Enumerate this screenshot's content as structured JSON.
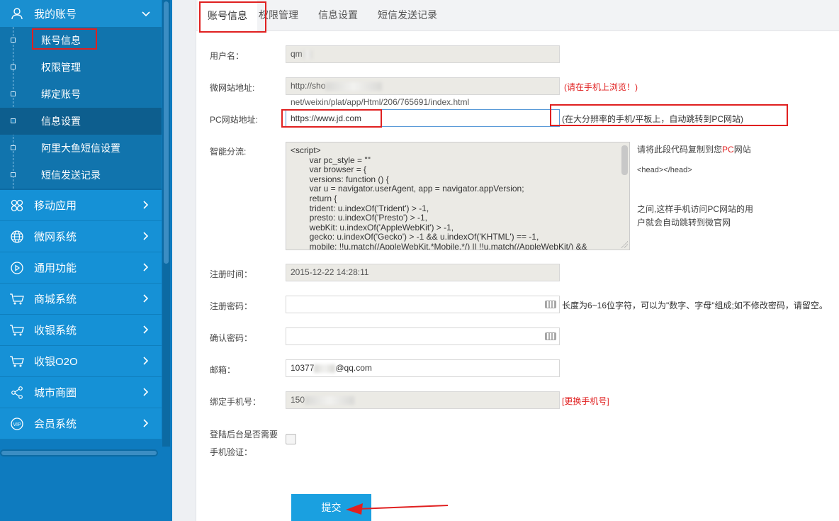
{
  "sidebar": {
    "account_section": {
      "label": "我的账号",
      "icon": "user-icon",
      "arrow": "⌄"
    },
    "account_items": [
      {
        "label": "账号信息"
      },
      {
        "label": "权限管理"
      },
      {
        "label": "绑定账号"
      },
      {
        "label": "信息设置"
      },
      {
        "label": "阿里大鱼短信设置"
      },
      {
        "label": "短信发送记录"
      }
    ],
    "sections": [
      {
        "label": "移动应用",
        "icon": "flower-icon",
        "arrow": "›"
      },
      {
        "label": "微网系统",
        "icon": "globe-icon",
        "arrow": "›"
      },
      {
        "label": "通用功能",
        "icon": "play-circle-icon",
        "arrow": "›"
      },
      {
        "label": "商城系统",
        "icon": "cart-icon",
        "arrow": "›"
      },
      {
        "label": "收银系统",
        "icon": "cart-icon",
        "arrow": "›"
      },
      {
        "label": "收银O2O",
        "icon": "cart-icon",
        "arrow": "›"
      },
      {
        "label": "城市商圈",
        "icon": "share-icon",
        "arrow": "›"
      },
      {
        "label": "会员系统",
        "icon": "vip-icon",
        "arrow": "›"
      }
    ]
  },
  "tabs": [
    {
      "label": "账号信息"
    },
    {
      "label": "权限管理"
    },
    {
      "label": "信息设置"
    },
    {
      "label": "短信发送记录"
    }
  ],
  "form": {
    "username": {
      "label": "用户名：",
      "value": "qm"
    },
    "mobile_site": {
      "label": "微网站地址:",
      "value_prefix": "http://sho",
      "value_suffix": "net/weixin/plat/app/Html/206/765691/index.html",
      "note": "(请在手机上浏览！)"
    },
    "pc_site": {
      "label": "PC网站地址:",
      "value": "https://www.jd.com",
      "note": "(在大分辨率的手机/平板上，自动跳转到PC网站)"
    },
    "smart_split": {
      "label": "智能分流:",
      "code": "<script>\n        var pc_style = \"\"\n        var browser = {\n        versions: function () {\n        var u = navigator.userAgent, app = navigator.appVersion;\n        return {\n        trident: u.indexOf('Trident') > -1,\n        presto: u.indexOf('Presto') > -1,\n        webKit: u.indexOf('AppleWebKit') > -1,\n        gecko: u.indexOf('Gecko') > -1 && u.indexOf('KHTML') == -1,\n        mobile: !!u.match(/AppleWebKit.*Mobile.*/) || !!u.match(/AppleWebKit/) &&",
      "hint_prefix": "请将此段代码复制到您",
      "hint_pc": "PC",
      "hint_suffix": "网站",
      "hint_head": "<head></head>",
      "hint_line3": "之间,这样手机访问PC网站的用",
      "hint_line4": "户就会自动跳转到微官网"
    },
    "register_time": {
      "label": "注册时间：",
      "value": "2015-12-22 14:28:11"
    },
    "register_password": {
      "label": "注册密码：",
      "value": "",
      "note": "长度为6~16位字符，可以为\"数字、字母\"组成;如不修改密码，请留空。"
    },
    "confirm_password": {
      "label": "确认密码：",
      "value": ""
    },
    "email": {
      "label": "邮箱：",
      "value_prefix": "10377",
      "value_suffix": "@qq.com"
    },
    "phone": {
      "label": "绑定手机号：",
      "value_prefix": "150",
      "note": "[更换手机号]"
    },
    "login_verify": {
      "label_line1": "登陆后台是否需要",
      "label_line2": "手机验证："
    },
    "submit_label": "提交"
  },
  "colors": {
    "sidebar_bg": "#0e7bbf",
    "accent_blue": "#1aa0e0",
    "annotation_red": "#e02020",
    "note_red": "#e02020"
  }
}
